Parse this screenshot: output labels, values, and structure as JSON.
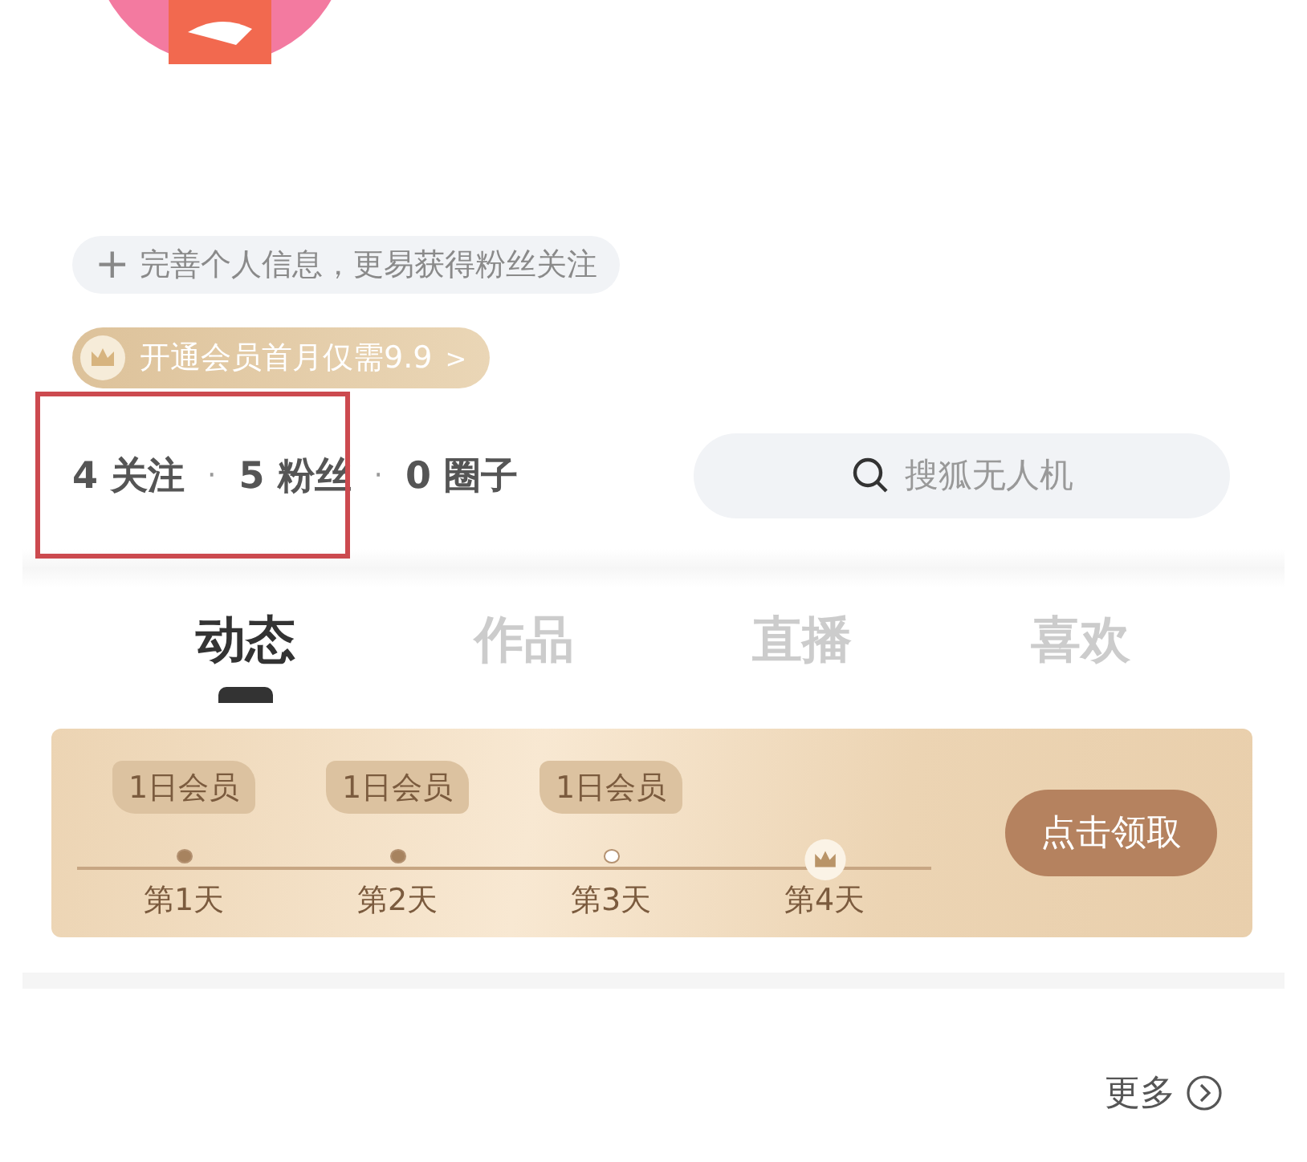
{
  "profile_hint": {
    "icon": "+",
    "text": "完善个人信息，更易获得粉丝关注"
  },
  "vip_promo": {
    "text": "开通会员首月仅需9.9",
    "chevron": ">"
  },
  "stats": [
    {
      "count": "4",
      "label": "关注"
    },
    {
      "count": "5",
      "label": "粉丝"
    },
    {
      "count": "0",
      "label": "圈子"
    }
  ],
  "stats_separator": "·",
  "search": {
    "placeholder": "搜狐无人机"
  },
  "tabs": [
    {
      "label": "动态",
      "selected": true
    },
    {
      "label": "作品",
      "selected": false
    },
    {
      "label": "直播",
      "selected": false
    },
    {
      "label": "喜欢",
      "selected": false
    }
  ],
  "checkin": {
    "days": [
      {
        "label": "第1天",
        "tag": "1日会员",
        "kind": "done"
      },
      {
        "label": "第2天",
        "tag": "1日会员",
        "kind": "done"
      },
      {
        "label": "第3天",
        "tag": "1日会员",
        "kind": "current"
      },
      {
        "label": "第4天",
        "kind": "reward"
      }
    ],
    "button": "点击领取"
  },
  "more": "更多"
}
